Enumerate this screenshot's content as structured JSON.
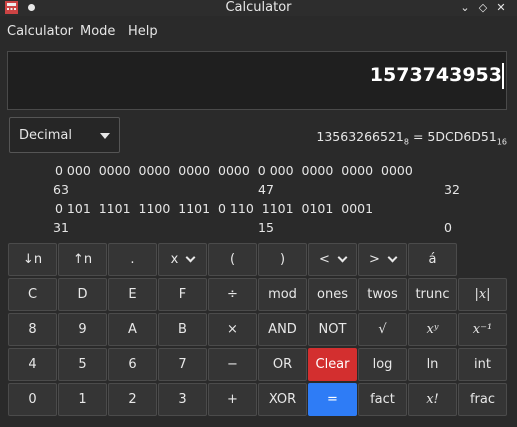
{
  "window": {
    "title": "Calculator",
    "buttons": [
      "⌄",
      "◇",
      "✕"
    ]
  },
  "menu": {
    "items": [
      "Calculator",
      "Mode",
      "Help"
    ]
  },
  "display": {
    "value": "1573743953"
  },
  "mode": {
    "selected": "Decimal"
  },
  "conversion": {
    "octal": "13563266521",
    "octal_base": "8",
    "equals": " = ",
    "hex": "5DCD6D51",
    "hex_base": "16"
  },
  "bits": {
    "row1": "0 000  0000  0000  0000  0000  0 000  0000  0000  0000",
    "row1_positions": [
      "63",
      "47",
      "32"
    ],
    "row2": "0 101  1101  1100  1101  0 110  1101  0101  0001",
    "row2_positions": [
      "31",
      "15",
      "0"
    ]
  },
  "keys": [
    [
      "↓n",
      "↑n",
      ".",
      "x",
      "(",
      ")",
      "<",
      ">",
      "á"
    ],
    [
      "C",
      "D",
      "E",
      "F",
      "÷",
      "mod",
      "ones",
      "twos",
      "trunc",
      "|x|"
    ],
    [
      "8",
      "9",
      "A",
      "B",
      "×",
      "AND",
      "NOT",
      "√",
      "xʸ",
      "x⁻¹"
    ],
    [
      "4",
      "5",
      "6",
      "7",
      "−",
      "OR",
      "Clear",
      "log",
      "ln",
      "int"
    ],
    [
      "0",
      "1",
      "2",
      "3",
      "+",
      "XOR",
      "=",
      "fact",
      "x!",
      "frac"
    ]
  ],
  "colors": {
    "clear": "#d32f2f",
    "equals": "#2e7cf6",
    "background": "#2a2a2a"
  }
}
